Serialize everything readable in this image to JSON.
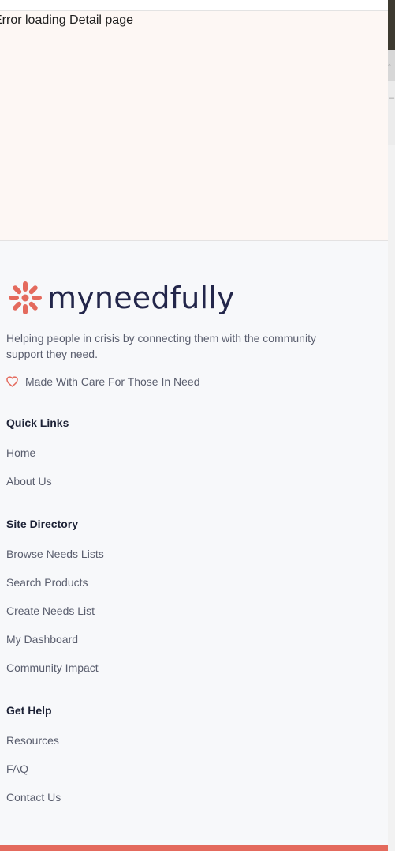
{
  "error": {
    "message": "Error loading Detail page"
  },
  "footer": {
    "brand": {
      "name": "myneedfully",
      "accent_color": "#e46a5d",
      "text_color": "#23264a"
    },
    "tagline": "Helping people in crisis by connecting them with the community support they need.",
    "care_line": "Made With Care For Those In Need",
    "care_icon": "heart-outline-icon",
    "quick_links": {
      "title": "Quick Links",
      "items": [
        "Home",
        "About Us"
      ]
    },
    "site_directory": {
      "title": "Site Directory",
      "items": [
        "Browse Needs Lists",
        "Search Products",
        "Create Needs List",
        "My Dashboard",
        "Community Impact"
      ]
    },
    "get_help": {
      "title": "Get Help",
      "items": [
        "Resources",
        "FAQ",
        "Contact Us"
      ]
    }
  }
}
